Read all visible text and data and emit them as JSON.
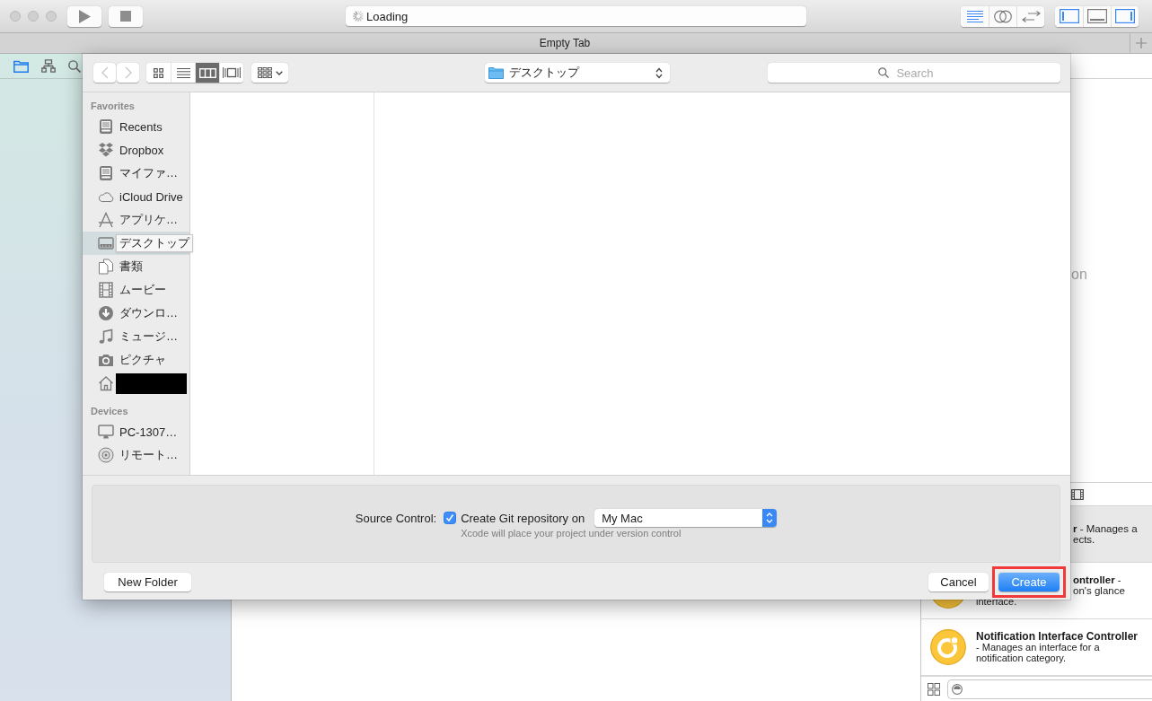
{
  "toolbar": {
    "activity": {
      "status": "Loading"
    },
    "editor_modes": [
      {
        "kind": "standard",
        "selected": true
      },
      {
        "kind": "assistant",
        "selected": false
      },
      {
        "kind": "version",
        "selected": false
      }
    ],
    "panels": [
      {
        "kind": "navigator",
        "on": true
      },
      {
        "kind": "debug",
        "on": false
      },
      {
        "kind": "utilities",
        "on": true
      }
    ]
  },
  "tab_bar": {
    "title": "Empty Tab"
  },
  "navigator": {
    "tabs": [
      {
        "kind": "project",
        "selected": true
      },
      {
        "kind": "symbol",
        "selected": false
      },
      {
        "kind": "find",
        "selected": false
      }
    ]
  },
  "inspector": {
    "message": "on"
  },
  "library": {
    "items": [
      {
        "kind": "covered",
        "selected": true,
        "lines": [
          "**r** - Manages a",
          "ects."
        ]
      },
      {
        "kind": "partly_covered",
        "selected": false,
        "lines": [
          "**ontroller** -",
          "on's glance"
        ],
        "description": "interface."
      },
      {
        "kind": "full",
        "selected": false,
        "title": "Notification Interface Controller",
        "description": "- Manages an interface for a notification category."
      }
    ]
  },
  "save_sheet": {
    "nav_buttons": [
      {
        "kind": "back",
        "disabled": true
      },
      {
        "kind": "forward",
        "disabled": true
      }
    ],
    "view_modes": [
      {
        "kind": "icons",
        "selected": false
      },
      {
        "kind": "list",
        "selected": false
      },
      {
        "kind": "columns",
        "selected": true
      },
      {
        "kind": "coverflow",
        "selected": false
      }
    ],
    "location": "デスクトップ",
    "search": {
      "placeholder": "Search"
    },
    "sidebar": [
      {
        "title": "Favorites",
        "items": [
          {
            "kind": "recents",
            "label": "Recents",
            "selected": false,
            "expanded": false
          },
          {
            "kind": "dropbox",
            "label": "Dropbox",
            "selected": false,
            "expanded": false
          },
          {
            "kind": "my_files",
            "label": "マイファ…",
            "selected": false,
            "expanded": false
          },
          {
            "kind": "icloud",
            "label": "iCloud Drive",
            "selected": false,
            "expanded": false
          },
          {
            "kind": "applications",
            "label": "アプリケ…",
            "selected": false,
            "expanded": false
          },
          {
            "kind": "desktop",
            "label": "デスクトップ",
            "selected": true,
            "expanded": true
          },
          {
            "kind": "documents",
            "label": "書類",
            "selected": false,
            "expanded": false
          },
          {
            "kind": "movies",
            "label": "ムービー",
            "selected": false,
            "expanded": false
          },
          {
            "kind": "downloads",
            "label": "ダウンロ…",
            "selected": false,
            "expanded": false
          },
          {
            "kind": "music",
            "label": "ミュージ…",
            "selected": false,
            "expanded": false
          },
          {
            "kind": "pictures",
            "label": "ピクチャ",
            "selected": false,
            "expanded": false
          },
          {
            "kind": "home",
            "redacted": true,
            "selected": false,
            "expanded": false
          }
        ]
      },
      {
        "title": "Devices",
        "items": [
          {
            "kind": "computer",
            "label": "PC-1307…",
            "selected": false,
            "expanded": false
          },
          {
            "kind": "remote_disc",
            "label": "リモート…",
            "selected": false,
            "expanded": false
          }
        ]
      }
    ],
    "source_control": {
      "label": "Source Control:",
      "checkbox": {
        "label": "Create Git repository on",
        "checked": true
      },
      "repository_location": "My Mac",
      "hint": "Xcode will place your project under version control"
    },
    "new_folder_button": "New Folder",
    "actions": [
      {
        "kind": "normal",
        "label": "Cancel",
        "highlighted": false
      },
      {
        "kind": "default",
        "label": "Create",
        "highlighted": true
      }
    ]
  }
}
